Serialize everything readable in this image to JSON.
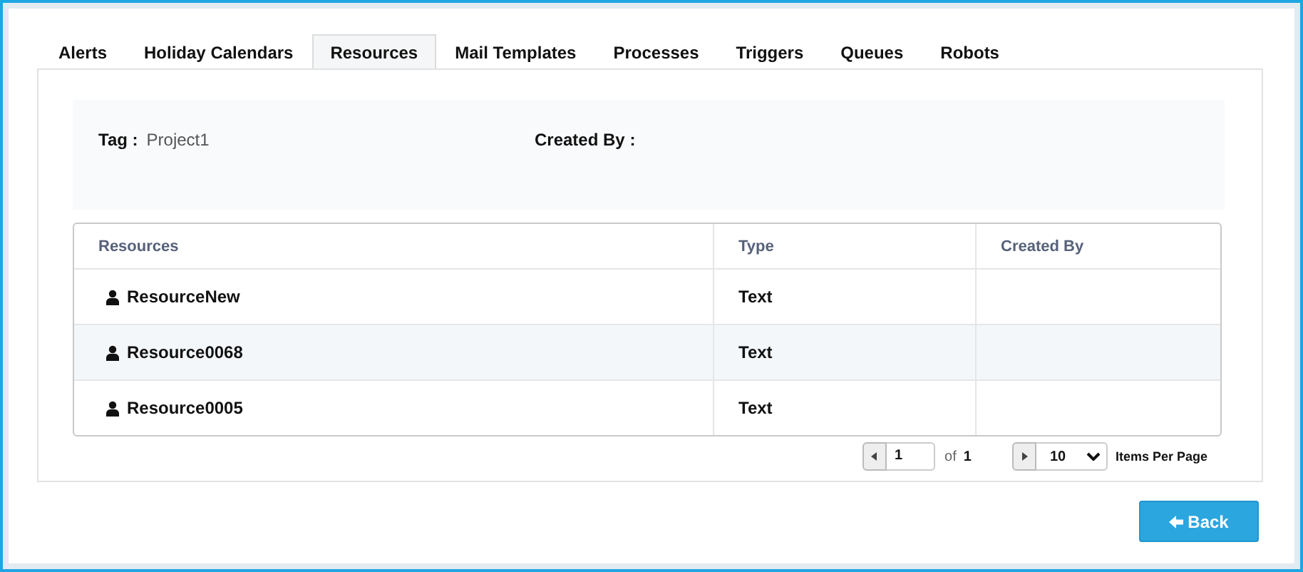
{
  "tabs": [
    {
      "label": "Alerts",
      "selected": false
    },
    {
      "label": "Holiday Calendars",
      "selected": false
    },
    {
      "label": "Resources",
      "selected": true
    },
    {
      "label": "Mail Templates",
      "selected": false
    },
    {
      "label": "Processes",
      "selected": false
    },
    {
      "label": "Triggers",
      "selected": false
    },
    {
      "label": "Queues",
      "selected": false
    },
    {
      "label": "Robots",
      "selected": false
    }
  ],
  "details": {
    "tag_label": "Tag :",
    "tag_value": "Project1",
    "created_by_label": "Created By :"
  },
  "table": {
    "columns": [
      "Resources",
      "Type",
      "Created By"
    ],
    "rows": [
      {
        "name": "ResourceNew",
        "type": "Text"
      },
      {
        "name": "Resource0068",
        "type": "Text"
      },
      {
        "name": "Resource0005",
        "type": "Text"
      }
    ]
  },
  "pagination": {
    "page": "1",
    "of": "of",
    "total": "1",
    "per_page": "10",
    "per_page_label": "Items Per Page"
  },
  "back_button": "Back"
}
